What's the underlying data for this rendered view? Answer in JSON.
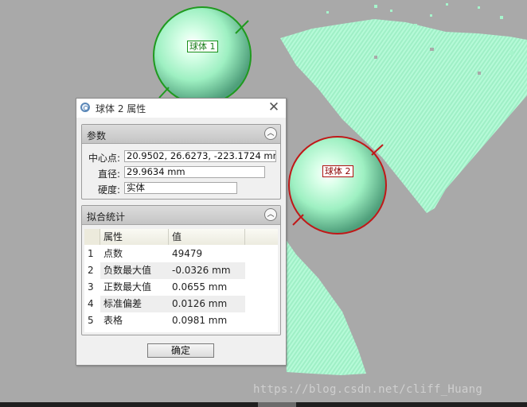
{
  "viewport": {
    "sphere1_label": "球体 1",
    "sphere2_label": "球体 2",
    "watermark": "https://blog.csdn.net/cliff_Huang"
  },
  "dialog": {
    "title": "球体 2 属性",
    "close_glyph": "✕",
    "params": {
      "title": "参数",
      "center_label": "中心点:",
      "center_value": "20.9502, 26.6273, -223.1724 mm",
      "diameter_label": "直径:",
      "diameter_value": "29.9634 mm",
      "hardness_label": "硬度:",
      "hardness_value": "实体"
    },
    "stats": {
      "title": "拟合统计",
      "columns": [
        "属性",
        "值"
      ],
      "rows": [
        {
          "num": "1",
          "prop": "点数",
          "value": "49479"
        },
        {
          "num": "2",
          "prop": "负数最大值",
          "value": "-0.0326 mm"
        },
        {
          "num": "3",
          "prop": "正数最大值",
          "value": "0.0655 mm"
        },
        {
          "num": "4",
          "prop": "标准偏差",
          "value": "0.0126 mm"
        },
        {
          "num": "5",
          "prop": "表格",
          "value": "0.0981 mm"
        }
      ]
    },
    "ok_label": "确定"
  },
  "colors": {
    "background": "#a9a9a9",
    "point_cloud": "#a6f5cc",
    "sphere1_ring": "#1f9a1f",
    "sphere2_ring": "#c01818"
  },
  "icons": [
    "sphere-properties-icon",
    "close-icon",
    "collapse-chevron-icon"
  ]
}
